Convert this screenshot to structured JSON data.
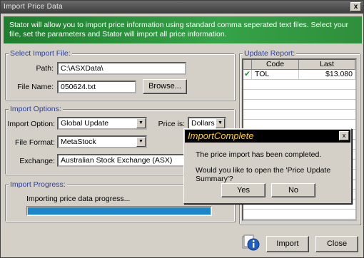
{
  "window": {
    "title": "Import Price Data",
    "close_glyph": "x"
  },
  "banner": {
    "text": "Stator will allow you to import price information using standard comma seperated text files. Select your file, set the parameters and Stator will import all price information."
  },
  "select_import_file": {
    "title": "Select Import File:",
    "path_label": "Path:",
    "path_value": "C:\\ASXData\\",
    "filename_label": "File Name:",
    "filename_value": "050624.txt",
    "browse_label": "Browse..."
  },
  "import_options": {
    "title": "Import Options:",
    "option_label": "Import Option:",
    "option_value": "Global Update",
    "price_label": "Price is:",
    "price_value": "Dollars",
    "format_label": "File Format:",
    "format_value": "MetaStock",
    "exchange_label": "Exchange:",
    "exchange_value": "Australian Stock Exchange (ASX)"
  },
  "import_progress": {
    "title": "Import Progress:",
    "status_text": "Importing price data progress...",
    "progress_fraction": 1.0
  },
  "update_report": {
    "title": "Update Report:",
    "columns": [
      "Code",
      "Last"
    ],
    "rows": [
      {
        "check": "✔",
        "code": "TOL",
        "last": "$13.080"
      }
    ]
  },
  "footer": {
    "import_label": "Import",
    "close_label": "Close",
    "icon": "info-icon"
  },
  "dialog": {
    "title": "ImportComplete",
    "message1": "The price import has been completed.",
    "message2": "Would you like to open the 'Price Update Summary'?",
    "yes_label": "Yes",
    "no_label": "No",
    "close_glyph": "x"
  },
  "colors": {
    "accent": "#2b3f9e",
    "banner": "#2f8f3c",
    "progress": "#1b86c9",
    "dialog_title": "#ffd200"
  }
}
